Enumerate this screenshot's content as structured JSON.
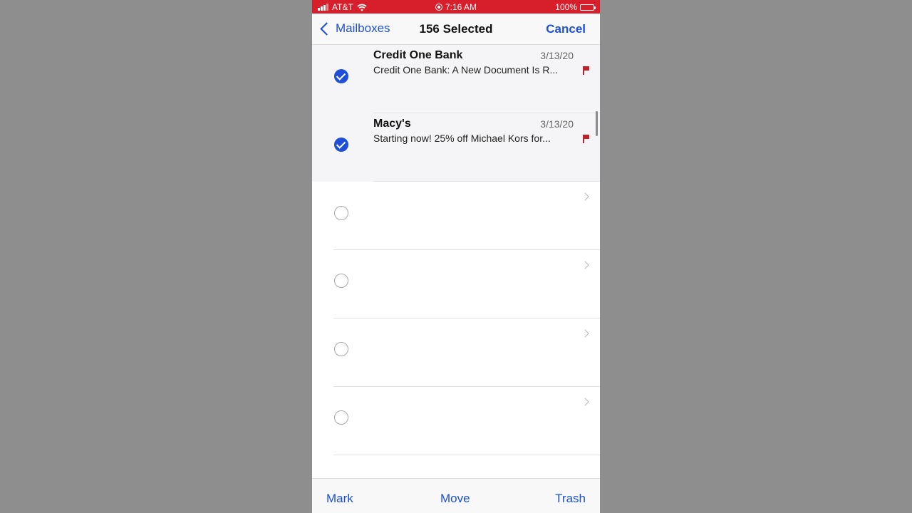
{
  "status_bar": {
    "carrier": "AT&T",
    "time": "7:16 AM",
    "battery": "100%",
    "icons": [
      "signal-icon",
      "wifi-icon",
      "screen-record-icon",
      "battery-icon"
    ]
  },
  "nav": {
    "back_label": "Mailboxes",
    "title": "156 Selected",
    "cancel_label": "Cancel"
  },
  "messages": [
    {
      "sender": "Credit One Bank",
      "date": "3/13/20",
      "subject": "Credit One Bank: A New Document Is R...",
      "selected": true,
      "flagged": true
    },
    {
      "sender": "Macy's",
      "date": "3/13/20",
      "subject": "Starting now! 25% off Michael Kors for...",
      "selected": true,
      "flagged": true
    }
  ],
  "toolbar": {
    "mark_label": "Mark",
    "move_label": "Move",
    "trash_label": "Trash"
  },
  "colors": {
    "status_bar": "#d71f2b",
    "accent": "#1d4fd8",
    "flag": "#c0202a"
  }
}
